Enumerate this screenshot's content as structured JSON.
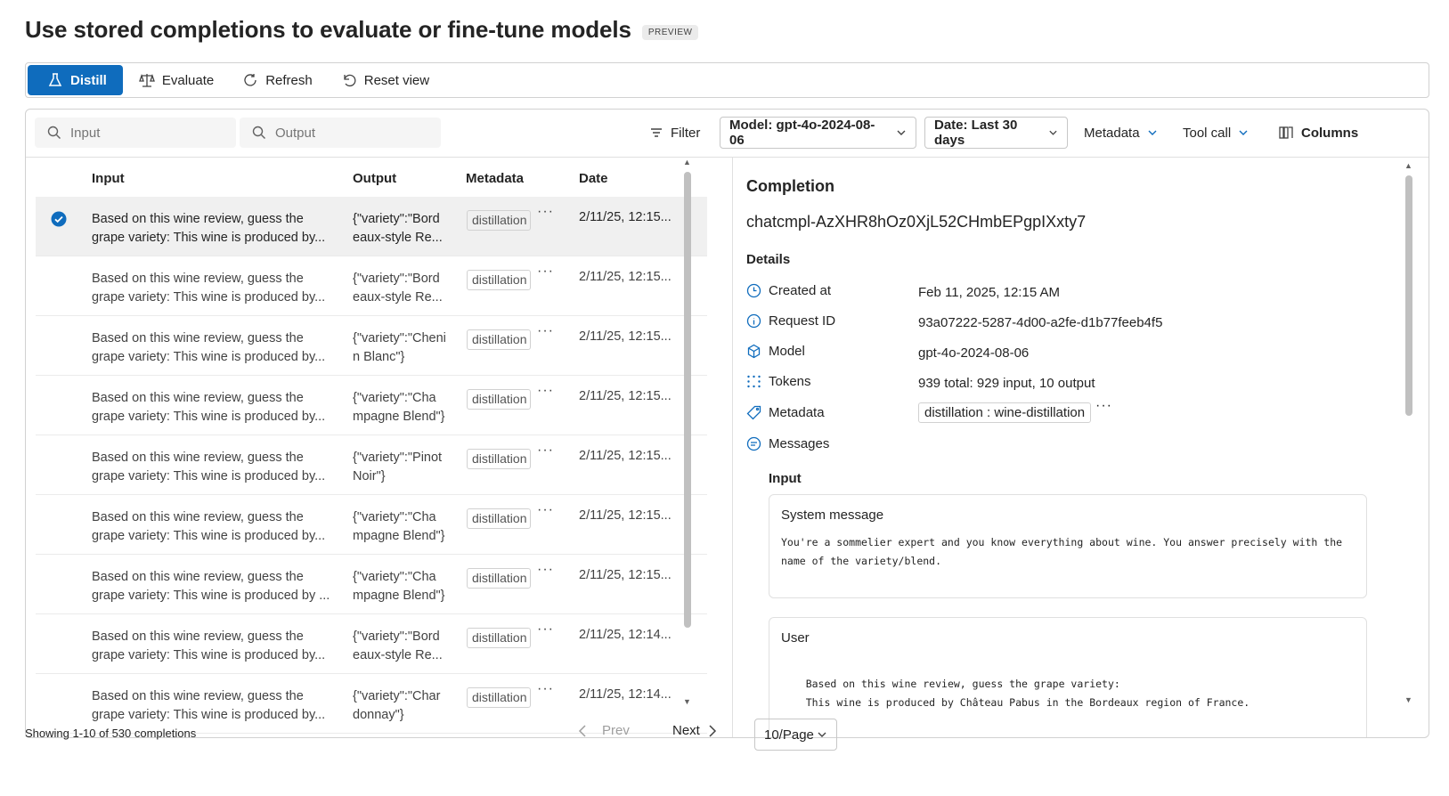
{
  "page": {
    "title": "Use stored completions to evaluate or fine-tune models",
    "badge": "PREVIEW"
  },
  "toolbar": {
    "distill": "Distill",
    "evaluate": "Evaluate",
    "refresh": "Refresh",
    "reset_view": "Reset view"
  },
  "filters": {
    "input_placeholder": "Input",
    "output_placeholder": "Output",
    "filter": "Filter",
    "model": "Model: gpt-4o-2024-08-06",
    "date": "Date: Last 30 days",
    "metadata": "Metadata",
    "tool_call": "Tool call",
    "columns": "Columns"
  },
  "table": {
    "headers": {
      "input": "Input",
      "output": "Output",
      "metadata": "Metadata",
      "date": "Date"
    },
    "rows": [
      {
        "input": "Based on this wine review, guess the\ngrape variety: This wine is produced by...",
        "output": "{\"variety\":\"Bord\neaux-style Re...",
        "metadata": "distillation",
        "date": "2/11/25, 12:15...",
        "selected": true
      },
      {
        "input": "Based on this wine review, guess the\ngrape variety: This wine is produced by...",
        "output": "{\"variety\":\"Bord\neaux-style Re...",
        "metadata": "distillation",
        "date": "2/11/25, 12:15...",
        "selected": false
      },
      {
        "input": "Based on this wine review, guess the\ngrape variety: This wine is produced by...",
        "output": "{\"variety\":\"Cheni\nn Blanc\"}",
        "metadata": "distillation",
        "date": "2/11/25, 12:15...",
        "selected": false
      },
      {
        "input": "Based on this wine review, guess the\ngrape variety: This wine is produced by...",
        "output": "{\"variety\":\"Cha\nmpagne Blend\"}",
        "metadata": "distillation",
        "date": "2/11/25, 12:15...",
        "selected": false
      },
      {
        "input": "Based on this wine review, guess the\ngrape variety: This wine is produced by...",
        "output": "{\"variety\":\"Pinot\nNoir\"}",
        "metadata": "distillation",
        "date": "2/11/25, 12:15...",
        "selected": false
      },
      {
        "input": "Based on this wine review, guess the\ngrape variety: This wine is produced by...",
        "output": "{\"variety\":\"Cha\nmpagne Blend\"}",
        "metadata": "distillation",
        "date": "2/11/25, 12:15...",
        "selected": false
      },
      {
        "input": "Based on this wine review, guess the\ngrape variety: This wine is produced by ...",
        "output": "{\"variety\":\"Cha\nmpagne Blend\"}",
        "metadata": "distillation",
        "date": "2/11/25, 12:15...",
        "selected": false
      },
      {
        "input": "Based on this wine review, guess the\ngrape variety: This wine is produced by...",
        "output": "{\"variety\":\"Bord\neaux-style Re...",
        "metadata": "distillation",
        "date": "2/11/25, 12:14...",
        "selected": false
      },
      {
        "input": "Based on this wine review, guess the\ngrape variety: This wine is produced by...",
        "output": "{\"variety\":\"Char\ndonnay\"}",
        "metadata": "distillation",
        "date": "2/11/25, 12:14...",
        "selected": false
      }
    ]
  },
  "detail": {
    "title": "Completion",
    "id": "chatcmpl-AzXHR8hOz0XjL52CHmbEPgpIXxty7",
    "details_label": "Details",
    "fields": {
      "created_at": {
        "label": "Created at",
        "value": "Feb 11, 2025, 12:15 AM"
      },
      "request_id": {
        "label": "Request ID",
        "value": "93a07222-5287-4d00-a2fe-d1b77feeb4f5"
      },
      "model": {
        "label": "Model",
        "value": "gpt-4o-2024-08-06"
      },
      "tokens": {
        "label": "Tokens",
        "value": "939 total: 929 input, 10 output"
      },
      "metadata": {
        "label": "Metadata",
        "value": "distillation : wine-distillation"
      }
    },
    "messages_label": "Messages",
    "input_label": "Input",
    "system_message": {
      "title": "System message",
      "body": "You're a sommelier expert and you know everything about wine. You answer precisely with the\nname of the variety/blend."
    },
    "user_message": {
      "title": "User",
      "body": "    Based on this wine review, guess the grape variety:\n    This wine is produced by Château Pabus in the Bordeaux region of France."
    }
  },
  "footer": {
    "count": "Showing 1-10 of 530 completions",
    "prev": "Prev",
    "next": "Next",
    "per_page": "10/Page"
  },
  "colors": {
    "accent": "#0f6cbd",
    "selected_row": "#f0f0f0"
  }
}
